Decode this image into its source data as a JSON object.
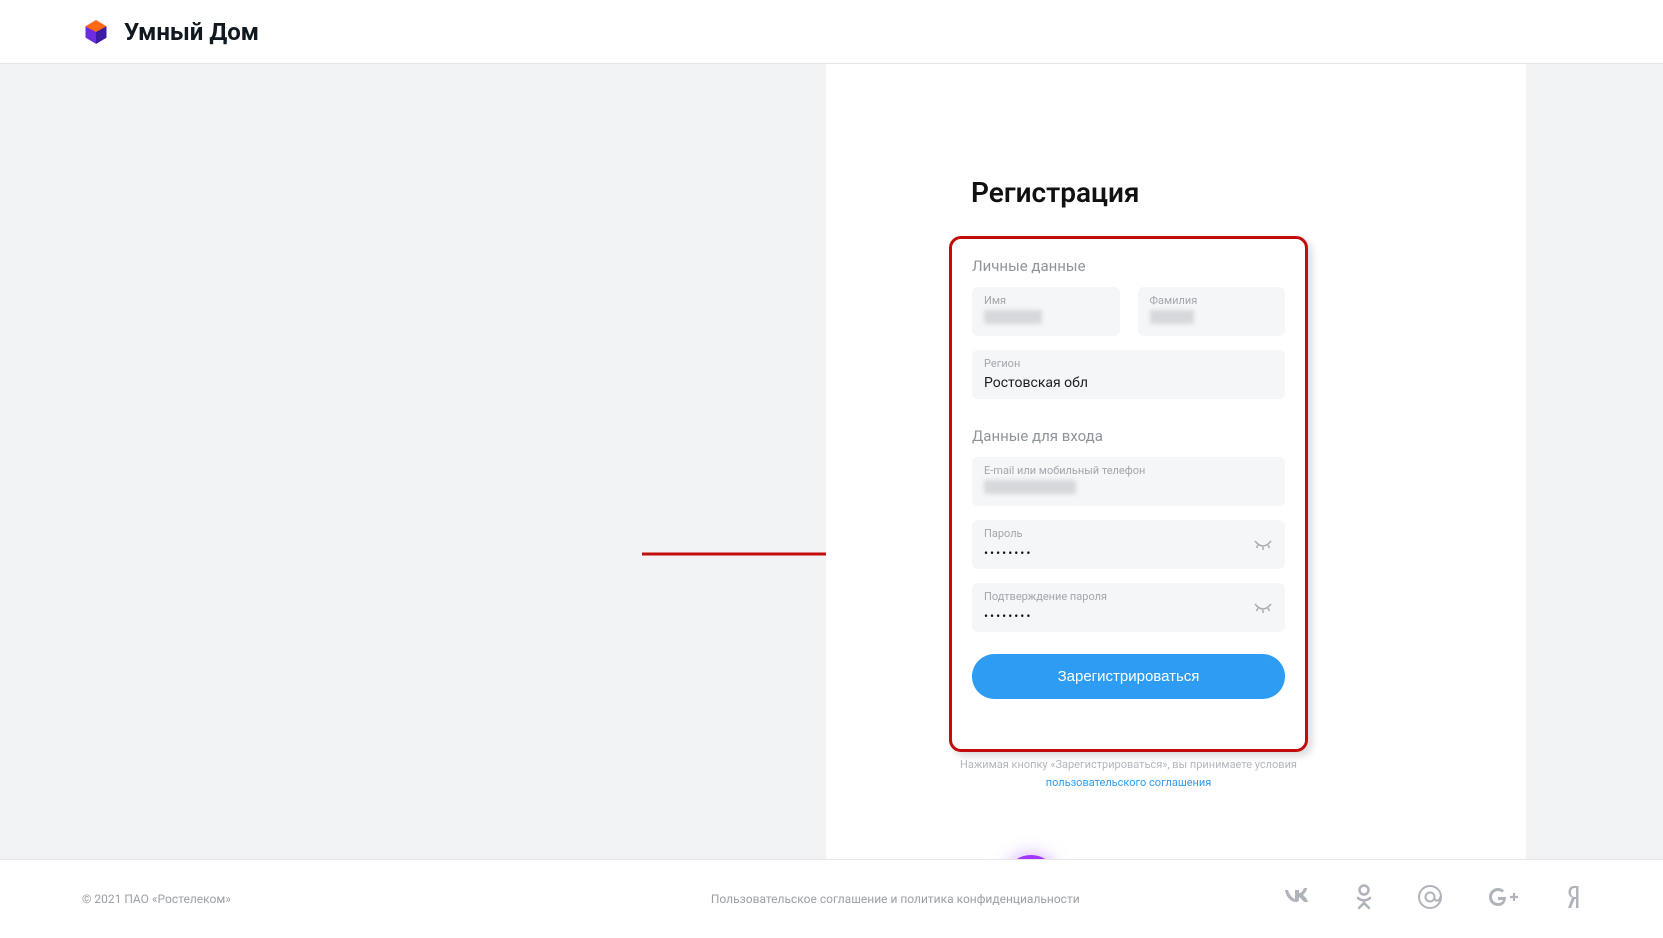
{
  "header": {
    "brand": "Умный Дом"
  },
  "page": {
    "title": "Регистрация",
    "section_personal": "Личные данные",
    "section_login": "Данные для входа"
  },
  "fields": {
    "first_name": {
      "label": "Имя",
      "value": ""
    },
    "last_name": {
      "label": "Фамилия",
      "value": ""
    },
    "region": {
      "label": "Регион",
      "value": "Ростовская обл"
    },
    "email": {
      "label": "E-mail или мобильный телефон",
      "value": ""
    },
    "password": {
      "label": "Пароль",
      "value": "••••••••"
    },
    "confirm": {
      "label": "Подтверждение пароля",
      "value": "••••••••"
    }
  },
  "button": {
    "register": "Зарегистрироваться"
  },
  "terms": {
    "prefix": "Нажимая кнопку «Зарегистрироваться», вы принимаете условия ",
    "link": "пользовательского соглашения"
  },
  "footer": {
    "copyright": "© 2021 ПАО «Ростелеком»",
    "policy": "Пользовательское соглашение и политика конфиденциальности"
  }
}
